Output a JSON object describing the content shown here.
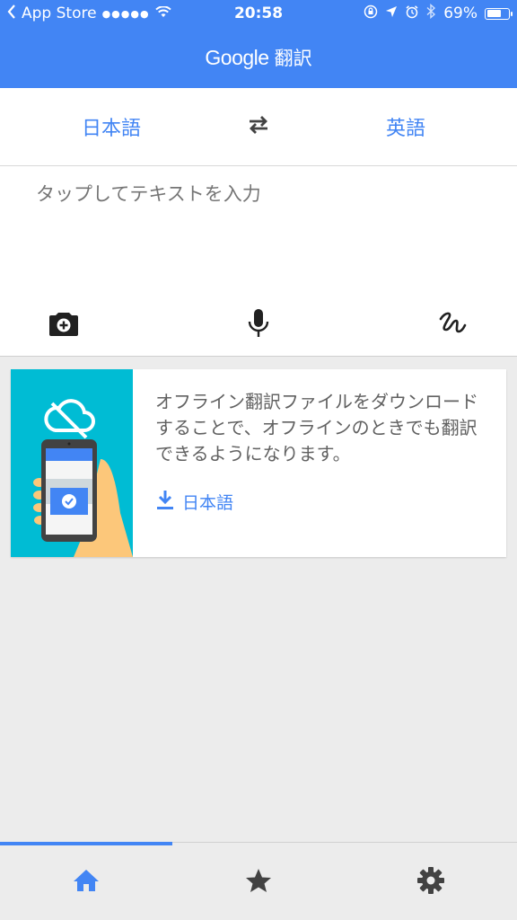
{
  "status_bar": {
    "back_app": "App Store",
    "signal": "●●●●●",
    "time": "20:58",
    "battery_percent": "69%",
    "battery_level": 0.69
  },
  "header": {
    "brand": "Google",
    "title": "翻訳"
  },
  "languages": {
    "source": "日本語",
    "target": "英語"
  },
  "input": {
    "placeholder": "タップしてテキストを入力"
  },
  "offline_card": {
    "text": "オフライン翻訳ファイルをダウンロードすることで、オフラインのときでも翻訳できるようになります。",
    "download_label": "日本語"
  },
  "nav": {
    "active_index": 0
  },
  "colors": {
    "accent": "#4285f4",
    "illustration_bg": "#00bcd4"
  }
}
